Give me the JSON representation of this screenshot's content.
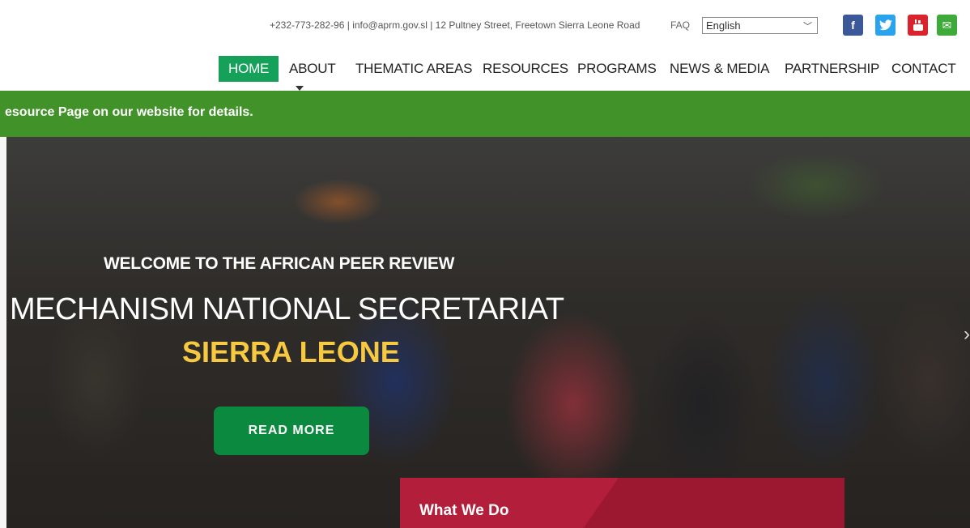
{
  "topbar": {
    "contact": "+232-773-282-96 | info@aprm.gov.sl | 12 Pultney Street, Freetown Sierra Leone Road",
    "faq": "FAQ",
    "language": "English",
    "social": {
      "facebook": "f",
      "twitter": "t",
      "youtube": "You",
      "mail": "✉"
    }
  },
  "nav": {
    "items": [
      "HOME",
      "ABOUT",
      "THEMATIC AREAS",
      "RESOURCES",
      "PROGRAMS",
      "NEWS & MEDIA",
      "PARTNERSHIP",
      "CONTACT"
    ]
  },
  "marquee": {
    "text": "esource Page on our website for details."
  },
  "hero": {
    "line1": "WELCOME TO THE AFRICAN PEER REVIEW",
    "line2": "MECHANISM NATIONAL SECRETARIAT",
    "line3": "SIERRA LEONE",
    "button": "READ MORE",
    "arrow": "›"
  },
  "what_we_do": {
    "title": "What We Do"
  },
  "colors": {
    "nav_active": "#15a15a",
    "marquee": "#42922a",
    "accent_yellow": "#f7c941",
    "button": "#0b8a3f",
    "panel": "#b31e3a"
  }
}
